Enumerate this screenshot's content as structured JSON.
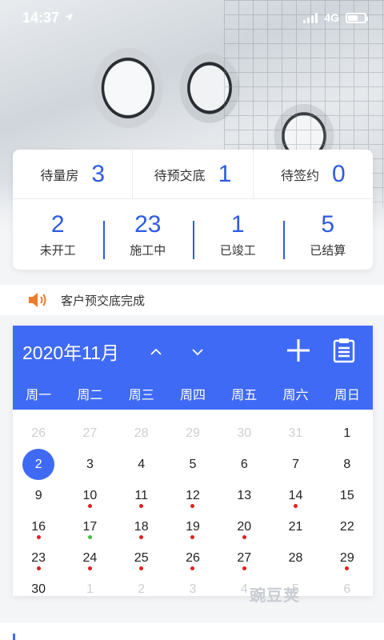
{
  "status": {
    "time": "14:37",
    "network": "4G"
  },
  "stats_top": [
    {
      "label": "待量房",
      "value": "3"
    },
    {
      "label": "待预交底",
      "value": "1"
    },
    {
      "label": "待签约",
      "value": "0"
    }
  ],
  "stats_bottom": [
    {
      "label": "未开工",
      "value": "2"
    },
    {
      "label": "施工中",
      "value": "23"
    },
    {
      "label": "已竣工",
      "value": "1"
    },
    {
      "label": "已结算",
      "value": "5"
    }
  ],
  "notice": {
    "icon": "speaker-icon",
    "text": "客户预交底完成"
  },
  "calendar": {
    "month_label": "2020年11月",
    "weekdays": [
      "周一",
      "周二",
      "周三",
      "周四",
      "周五",
      "周六",
      "周日"
    ],
    "weeks": [
      [
        {
          "d": "26",
          "muted": true
        },
        {
          "d": "27",
          "muted": true
        },
        {
          "d": "28",
          "muted": true
        },
        {
          "d": "29",
          "muted": true
        },
        {
          "d": "30",
          "muted": true
        },
        {
          "d": "31",
          "muted": true
        },
        {
          "d": "1"
        }
      ],
      [
        {
          "d": "2",
          "selected": true
        },
        {
          "d": "3"
        },
        {
          "d": "4"
        },
        {
          "d": "5"
        },
        {
          "d": "6"
        },
        {
          "d": "7"
        },
        {
          "d": "8"
        }
      ],
      [
        {
          "d": "9"
        },
        {
          "d": "10",
          "dot": "red"
        },
        {
          "d": "11",
          "dot": "red"
        },
        {
          "d": "12",
          "dot": "red"
        },
        {
          "d": "13"
        },
        {
          "d": "14",
          "dot": "red"
        },
        {
          "d": "15"
        }
      ],
      [
        {
          "d": "16",
          "dot": "red"
        },
        {
          "d": "17",
          "dot": "green"
        },
        {
          "d": "18",
          "dot": "red"
        },
        {
          "d": "19",
          "dot": "red"
        },
        {
          "d": "20",
          "dot": "red"
        },
        {
          "d": "21"
        },
        {
          "d": "22"
        }
      ],
      [
        {
          "d": "23",
          "dot": "red"
        },
        {
          "d": "24",
          "dot": "red"
        },
        {
          "d": "25",
          "dot": "red"
        },
        {
          "d": "26",
          "dot": "red"
        },
        {
          "d": "27",
          "dot": "red"
        },
        {
          "d": "28"
        },
        {
          "d": "29",
          "dot": "red"
        }
      ],
      [
        {
          "d": "30",
          "dot": "red"
        },
        {
          "d": "1",
          "muted": true
        },
        {
          "d": "2",
          "muted": true
        },
        {
          "d": "3",
          "muted": true
        },
        {
          "d": "4",
          "muted": true,
          "dot": "red"
        },
        {
          "d": "5",
          "muted": true
        },
        {
          "d": "6",
          "muted": true
        }
      ]
    ]
  },
  "watermark": "豌豆荚",
  "colors": {
    "accent": "#3f6af5",
    "number": "#2e5be3",
    "dot_red": "#e0201e",
    "dot_green": "#3fc33c"
  }
}
